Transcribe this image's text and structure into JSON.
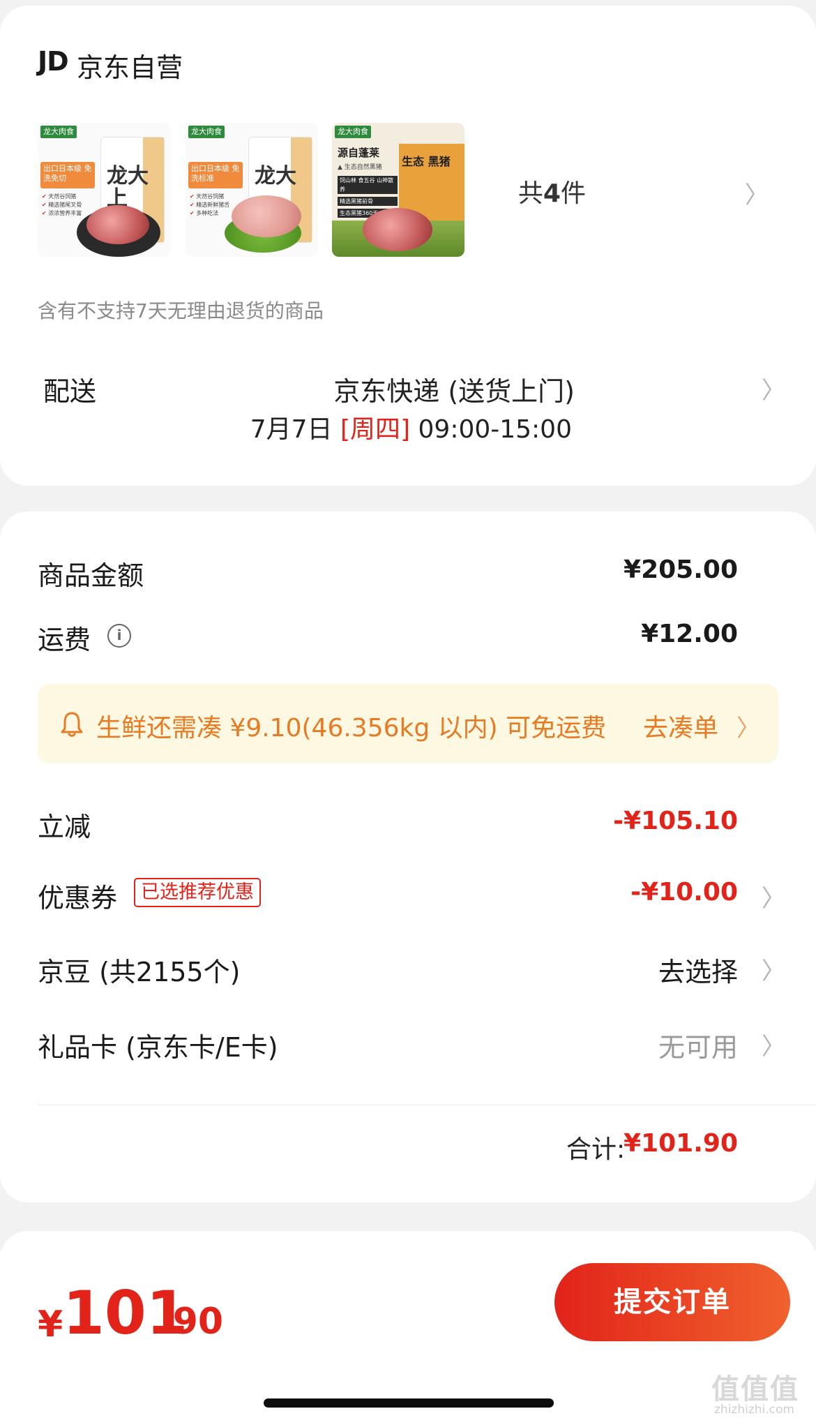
{
  "store": {
    "logo": "JD",
    "name": "京东自营"
  },
  "products": [
    {
      "brand": "龙大肉食",
      "pkg_mark": "龙大上",
      "sticker": "出口日本级 免洗免切",
      "features": [
        "天然谷饲猪",
        "精选猪尾叉骨",
        "浓浓营养丰富"
      ]
    },
    {
      "brand": "龙大肉食",
      "pkg_mark": "龙大",
      "sticker": "出口日本级 免洗标准",
      "features": [
        "天然谷饲猪",
        "精选新鲜猪舌",
        "多种吃法"
      ]
    },
    {
      "brand": "龙大肉食",
      "title": "源自蓬莱",
      "subtitle": "▲ 生态自然黑猪",
      "bag_text": "生态 黑猪",
      "lines": [
        "饲山林 食五谷 山神散养",
        "精选黑猪前骨",
        "生态黑猪360天"
      ]
    }
  ],
  "items_count": {
    "prefix": "共",
    "count": "4",
    "suffix": "件"
  },
  "return_note": "含有不支持7天无理由退货的商品",
  "delivery": {
    "label": "配送",
    "method": "京东快递 (送货上门)",
    "date": "7月7日 ",
    "weekday": "[周四]",
    "time_range": " 09:00-15:00"
  },
  "pricing": {
    "goods_label": "商品金额",
    "goods_value": "¥205.00",
    "shipping_label": "运费",
    "shipping_value": "¥12.00",
    "fresh_notice": "生鲜还需凑 ¥9.10(46.356kg 以内) 可免运费",
    "fresh_action": "去凑单",
    "discount_label": "立减",
    "discount_value": "-¥105.10",
    "coupon_label": "优惠券",
    "coupon_tag": "已选推荐优惠",
    "coupon_value": "-¥10.00",
    "jingdou_label": "京豆 (共2155个)",
    "jingdou_value": "去选择",
    "giftcard_label": "礼品卡 (京东卡/E卡)",
    "giftcard_value": "无可用",
    "total_label": "合计:",
    "total_value": "¥101.90"
  },
  "payment": {
    "currency": "¥",
    "amount_int": "101",
    "amount_dec": ".90",
    "submit_label": "提交订单"
  },
  "watermark": {
    "text": "值值值",
    "url": "zhizhizhi.com"
  },
  "colors": {
    "accent": "#e2231a",
    "notice_bg": "#fcf8e1",
    "notice_text": "#e77b24"
  },
  "icons": [
    "chevron-right-icon",
    "info-icon",
    "bell-icon"
  ]
}
